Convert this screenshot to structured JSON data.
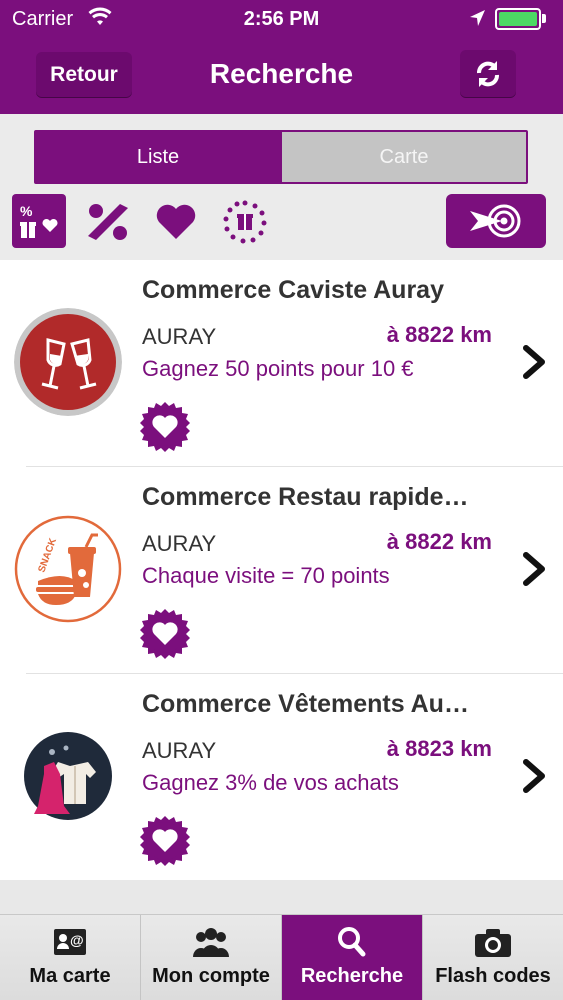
{
  "status_bar": {
    "carrier": "Carrier",
    "time": "2:56 PM"
  },
  "nav": {
    "back_label": "Retour",
    "title": "Recherche"
  },
  "segmented": {
    "list_label": "Liste",
    "map_label": "Carte",
    "selected": "Liste"
  },
  "filters": {
    "icons": [
      "percent-gift-heart-icon",
      "percent-icon",
      "heart-icon",
      "dotted-gift-icon"
    ],
    "locate_icon": "target-icon"
  },
  "results": [
    {
      "name": "Commerce Caviste Auray",
      "city": "AURAY",
      "distance": "à 8822 km",
      "promo": "Gagnez 50 points pour 10 €",
      "logo_icon": "wine-glasses-icon"
    },
    {
      "name": "Commerce Restau rapide…",
      "city": "AURAY",
      "distance": "à 8822 km",
      "promo": "Chaque visite = 70 points",
      "logo_icon": "snack-icon",
      "logo_text": "SNACK"
    },
    {
      "name": "Commerce Vêtements Au…",
      "city": "AURAY",
      "distance": "à 8823 km",
      "promo": "Gagnez 3% de vos achats",
      "logo_icon": "clothes-icon"
    }
  ],
  "tabs": [
    {
      "label": "Ma carte",
      "icon": "id-card-icon",
      "active": false
    },
    {
      "label": "Mon compte",
      "icon": "people-icon",
      "active": false
    },
    {
      "label": "Recherche",
      "icon": "search-icon",
      "active": true
    },
    {
      "label": "Flash codes",
      "icon": "camera-icon",
      "active": false
    }
  ],
  "colors": {
    "brand": "#7b0f7d",
    "text": "#333333",
    "background": "#ebebeb"
  }
}
